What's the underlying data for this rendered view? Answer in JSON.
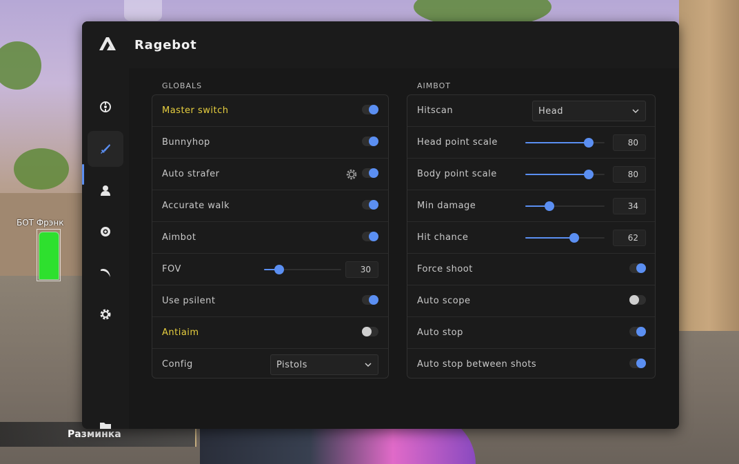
{
  "game": {
    "player_name": "БОТ Фрэнк",
    "warmup_label": "Разминка"
  },
  "menu": {
    "title": "Ragebot",
    "sidebar": {
      "items": [
        {
          "icon": "crosshair-icon",
          "active": false
        },
        {
          "icon": "knife-icon",
          "active": true
        },
        {
          "icon": "user-icon",
          "active": false
        },
        {
          "icon": "eye-icon",
          "active": false
        },
        {
          "icon": "scythe-icon",
          "active": false
        },
        {
          "icon": "gear-icon",
          "active": false
        }
      ],
      "bottom_icon": "folder-icon"
    },
    "accent_color": "#5b8ff2",
    "highlight_color": "#e7cf3f"
  },
  "globals": {
    "title": "GLOBALS",
    "master_switch": {
      "label": "Master switch",
      "on": true
    },
    "bunnyhop": {
      "label": "Bunnyhop",
      "on": true
    },
    "auto_strafer": {
      "label": "Auto strafer",
      "on": true
    },
    "accurate_walk": {
      "label": "Accurate walk",
      "on": true
    },
    "aimbot": {
      "label": "Aimbot",
      "on": true
    },
    "fov": {
      "label": "FOV",
      "value": "30",
      "fraction": 0.2
    },
    "use_psilent": {
      "label": "Use psilent",
      "on": true
    },
    "antiaim": {
      "label": "Antiaim",
      "on": false
    },
    "config": {
      "label": "Config",
      "value": "Pistols"
    }
  },
  "aimbot": {
    "title": "AIMBOT",
    "hitscan": {
      "label": "Hitscan",
      "value": "Head"
    },
    "head_point_scale": {
      "label": "Head point scale",
      "value": "80",
      "fraction": 0.8
    },
    "body_point_scale": {
      "label": "Body point scale",
      "value": "80",
      "fraction": 0.8
    },
    "min_damage": {
      "label": "Min damage",
      "value": "34",
      "fraction": 0.3
    },
    "hit_chance": {
      "label": "Hit chance",
      "value": "62",
      "fraction": 0.62
    },
    "force_shoot": {
      "label": "Force shoot",
      "on": true
    },
    "auto_scope": {
      "label": "Auto scope",
      "on": false
    },
    "auto_stop": {
      "label": "Auto stop",
      "on": true
    },
    "auto_stop_between_shots": {
      "label": "Auto stop between shots",
      "on": true
    }
  }
}
